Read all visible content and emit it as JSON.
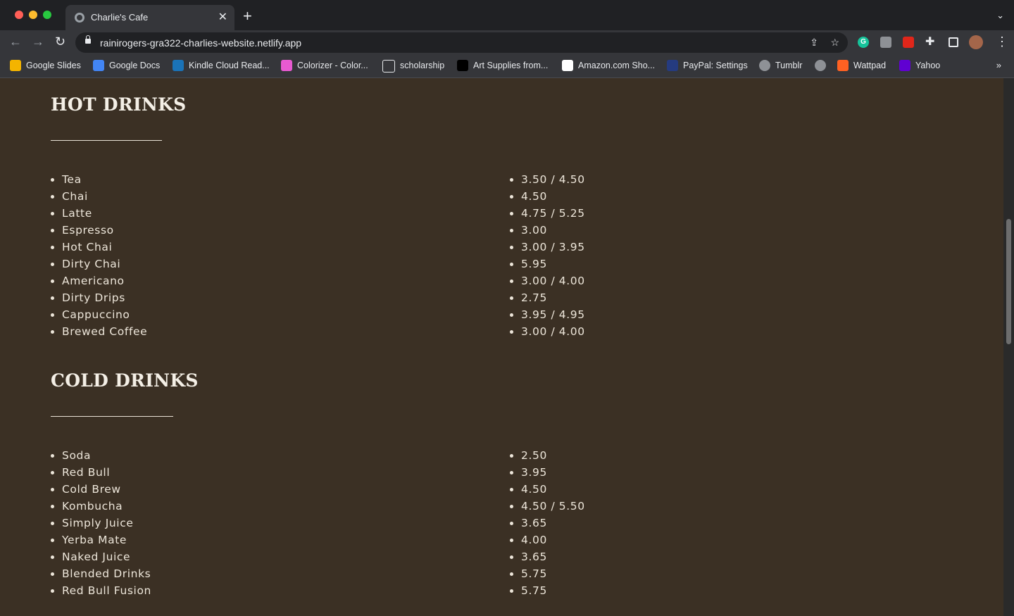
{
  "browser": {
    "tab_title": "Charlie's Cafe",
    "tab_close": "✕",
    "new_tab": "+",
    "tab_search": "⌄",
    "url": "rainirogers-gra322-charlies-website.netlify.app",
    "nav": {
      "back": "←",
      "forward": "→",
      "reload": "↻"
    },
    "bookmarks": [
      {
        "label": "Google Slides",
        "icon": "slides-icon",
        "color": "#f4b400"
      },
      {
        "label": "Google Docs",
        "icon": "docs-icon",
        "color": "#4285f4"
      },
      {
        "label": "Kindle Cloud Read...",
        "icon": "kindle-icon",
        "color": "#1a73b8"
      },
      {
        "label": "Colorizer - Color...",
        "icon": "colorizer-icon",
        "color": "#e85ad1"
      },
      {
        "label": "scholarship",
        "icon": "folder-icon",
        "color": "#35363a"
      },
      {
        "label": "Art Supplies from...",
        "icon": "blick-icon",
        "color": "#000000"
      },
      {
        "label": "Amazon.com Sho...",
        "icon": "amazon-icon",
        "color": "#ffffff"
      },
      {
        "label": "PayPal: Settings",
        "icon": "paypal-icon",
        "color": "#253b80"
      },
      {
        "label": "Tumblr",
        "icon": "globe-icon",
        "color": "#8e9196"
      },
      {
        "label": "",
        "icon": "globe-icon",
        "color": "#8e9196"
      },
      {
        "label": "Wattpad",
        "icon": "wattpad-icon",
        "color": "#ff6122"
      },
      {
        "label": "Yahoo",
        "icon": "yahoo-icon",
        "color": "#6001d2"
      }
    ],
    "bookmarks_more": "»"
  },
  "menu": {
    "hot": {
      "title": "HOT DRINKS",
      "items": [
        {
          "name": "Tea",
          "price": "3.50 / 4.50"
        },
        {
          "name": "Chai",
          "price": "4.50"
        },
        {
          "name": "Latte",
          "price": "4.75 / 5.25"
        },
        {
          "name": "Espresso",
          "price": "3.00"
        },
        {
          "name": "Hot Chai",
          "price": "3.00 / 3.95"
        },
        {
          "name": "Dirty Chai",
          "price": "5.95"
        },
        {
          "name": "Americano",
          "price": "3.00 / 4.00"
        },
        {
          "name": "Dirty Drips",
          "price": "2.75"
        },
        {
          "name": "Cappuccino",
          "price": "3.95 / 4.95"
        },
        {
          "name": "Brewed Coffee",
          "price": "3.00 / 4.00"
        }
      ]
    },
    "cold": {
      "title": "COLD DRINKS",
      "items": [
        {
          "name": "Soda",
          "price": "2.50"
        },
        {
          "name": "Red Bull",
          "price": "3.95"
        },
        {
          "name": "Cold Brew",
          "price": "4.50"
        },
        {
          "name": "Kombucha",
          "price": "4.50 / 5.50"
        },
        {
          "name": "Simply Juice",
          "price": "3.65"
        },
        {
          "name": "Yerba Mate",
          "price": "4.00"
        },
        {
          "name": "Naked Juice",
          "price": "3.65"
        },
        {
          "name": "Blended Drinks",
          "price": "5.75"
        },
        {
          "name": "Red Bull Fusion",
          "price": "5.75"
        }
      ]
    }
  },
  "colors": {
    "page_background": "#3b3024",
    "text": "#ede6da"
  }
}
